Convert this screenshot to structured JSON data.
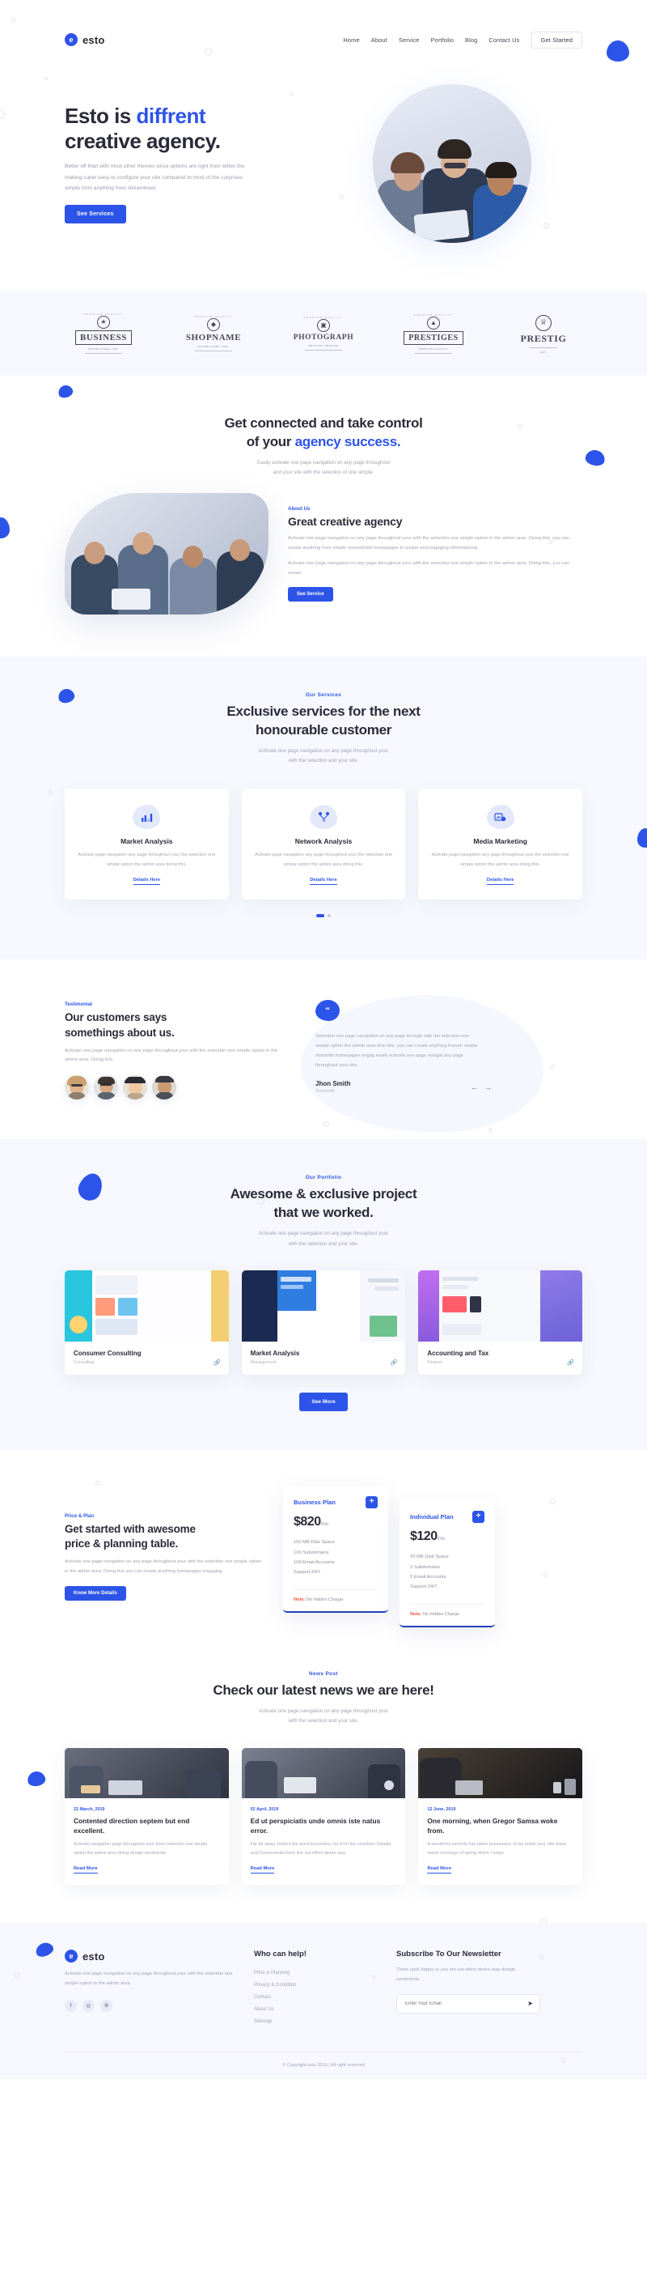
{
  "brand": {
    "name": "esto",
    "mark": "e"
  },
  "nav": {
    "items": [
      {
        "label": "Home"
      },
      {
        "label": "About"
      },
      {
        "label": "Service"
      },
      {
        "label": "Portfolio"
      },
      {
        "label": "Blog"
      },
      {
        "label": "Contact Us"
      }
    ],
    "cta": "Get Started"
  },
  "hero": {
    "title_a": "Esto is ",
    "title_accent": "diffrent",
    "title_b": "creative agency.",
    "desc": "Better off than with most other themes since options are right from within the making super easy to configure your site compared to most of the surprises simple from anything from streamlined.",
    "button": "See Services"
  },
  "clients": {
    "logos": [
      {
        "arc": "PREMIUM QUALITY",
        "main": "BUSINESS",
        "tiny": "ESTABLISHED 1981",
        "boxed": true
      },
      {
        "arc": "PREMIUM QUALITY",
        "main": "SHOPNAME",
        "tiny": "ESTABLISHED 1981",
        "boxed": false
      },
      {
        "arc": "PREMIUM QUALITY",
        "main": "PHOTOGRAPH",
        "tiny": "ORIGINAL SERVICE",
        "boxed": false
      },
      {
        "arc": "PREMIUM QUALITY",
        "main": "PRESTIGES",
        "tiny": "PREMIUM QUALITY",
        "boxed": true
      },
      {
        "arc": "",
        "main": "PRESTIG",
        "tiny": "EST",
        "boxed": false
      }
    ]
  },
  "connected": {
    "title_a": "Get connected and take control",
    "title_b": "of your ",
    "title_accent": "agency success.",
    "desc_l1": "Easily activate one page navigation on any page throughout",
    "desc_l2": "and your site with the selection of one simple."
  },
  "about": {
    "kicker": "About Us",
    "title": "Great creative agency",
    "p1": "Activate one page navigation on any page throughout your with the selection one simple option in the admin area. Doing this, you can create anything from simple streamlined homepages to unque and engaging informational.",
    "p2": "Activate one page navigation on any page throughout your with the selection one simple option in the admin area. Doing this, you can create.",
    "button": "See Service"
  },
  "services": {
    "label": "Our Services",
    "title_l1": "Exclusive services for the next",
    "title_l2": "honourable customer",
    "desc_l1": "Activate one page navigation on any page throughout your",
    "desc_l2": "with the selection and your site.",
    "cards": [
      {
        "icon": "bar-chart-icon",
        "title": "Market Analysis",
        "desc": "Activate page navigation any page throughout your the selection one simple option the admin area doing this.",
        "link": "Details Here"
      },
      {
        "icon": "network-icon",
        "title": "Network Analysis",
        "desc": "Activate page navigation any page throughout your the selection one simple option the admin area doing this.",
        "link": "Details Here"
      },
      {
        "icon": "media-icon",
        "title": "Media Marketing",
        "desc": "Activate page navigation any page throughout your the selection one simple option the admin area doing this.",
        "link": "Details Here"
      }
    ]
  },
  "testimonial": {
    "kicker": "Testimonial",
    "title_l1": "Our customers says",
    "title_l2": "somethings about us.",
    "desc": "Activate one page navigation on any page throughout your with the selection one simple option in the admin area. Doing this.",
    "quote_mark": "“",
    "quote": "Selection one page navigation on any page through with the selection one simple option the admin area doin this, you can create anything fromen simple streamlin homepages engag easily activate one page navigat any page throughout your site.",
    "author": "Jhon Smith",
    "role": "Techsmith",
    "prev_icon": "←",
    "next_icon": "→"
  },
  "portfolio": {
    "label": "Our Portfolio",
    "title_l1": "Awesome & exclusive project",
    "title_l2": "that we worked.",
    "desc_l1": "Activate one page navigation on any page throughout your",
    "desc_l2": "with the selection and your site.",
    "items": [
      {
        "title": "Consumer Consulting",
        "cat": "Consulting",
        "link_icon": "link-icon"
      },
      {
        "title": "Market Analysis",
        "cat": "Management",
        "link_icon": "link-icon"
      },
      {
        "title": "Accounting and Tax",
        "cat": "Finance",
        "link_icon": "link-icon"
      }
    ],
    "button": "See More"
  },
  "price": {
    "kicker": "Price & Plan",
    "title_l1": "Get started with awesome",
    "title_l2": "price & planning table.",
    "desc": "Activate one page navigation on any page throughout your with the selection one simple option in the admin area. Doing this you can create anything homepages engaging.",
    "button": "Know More Details",
    "plans": [
      {
        "name": "Business Plan",
        "amount": "$820",
        "period": "/mo",
        "features": [
          "150 MB Disk Space",
          "100 Subdomains",
          "100 Email Accounts",
          "Support 24/7"
        ],
        "note_label": "Note:",
        "note_text": " No hidden Charge",
        "plus_icon": "+"
      },
      {
        "name": "Individual Plan",
        "amount": "$120",
        "period": "/mo",
        "features": [
          "20 MB Disk Space",
          "2 Subdomains",
          "5 Email Accounts",
          "Support 24/7"
        ],
        "note_label": "Note:",
        "note_text": " No hidden Charge",
        "plus_icon": "+"
      }
    ]
  },
  "news": {
    "label": "News Post",
    "title": "Check our latest news we are here!",
    "desc_l1": "Activate one page navigation on any page throughout your",
    "desc_l2": "with the selection and your site.",
    "posts": [
      {
        "date": "22 March, 2019",
        "title": "Contented direction septem but end excellent.",
        "excerpt": "Activate navigation page throughout your them selection one simple option the admin area doing design sentiments.",
        "link": "Read More"
      },
      {
        "date": "02 April, 2019",
        "title": "Ed ut perspiciatis unde omnis iste natus error.",
        "excerpt": "Far far away, behind the word mountains, far from the countries Vokalia and Consonantia there live out effect desire way.",
        "link": "Read More"
      },
      {
        "date": "12 June, 2019",
        "title": "One morning, when Gregor Samsa woke from.",
        "excerpt": "A wonderful serenity has taken possession of my entire soul, like these sweet mornings of spring which I enjoy.",
        "link": "Read More"
      }
    ]
  },
  "footer": {
    "brand": "esto",
    "about": "Activate one page navigation on any page throughout your with the selection one simple option in the admin area.",
    "socials": [
      {
        "icon": "facebook-icon",
        "glyph": "f"
      },
      {
        "icon": "instagram-icon",
        "glyph": "◎"
      },
      {
        "icon": "dribbble-icon",
        "glyph": "⑨"
      }
    ],
    "help_title": "Who can help!",
    "help_links": [
      "Price & Planning",
      "Privacy & Condition",
      "Contact",
      "About Us",
      "Sitemap"
    ],
    "news_title": "Subscribe To Our Newsletter",
    "news_desc": "There spok happy or you om out effect desire way design sentiments.",
    "email_placeholder": "Enter Your Email",
    "send_icon": "➤",
    "copyright": "© Copyright esto 2019 | All right reserved"
  },
  "colors": {
    "accent": "#2d54e8",
    "dark": "#2b2b39",
    "muted": "#a2a4b4",
    "bg_tint": "#f6f8fd",
    "note": "#f0564a"
  }
}
